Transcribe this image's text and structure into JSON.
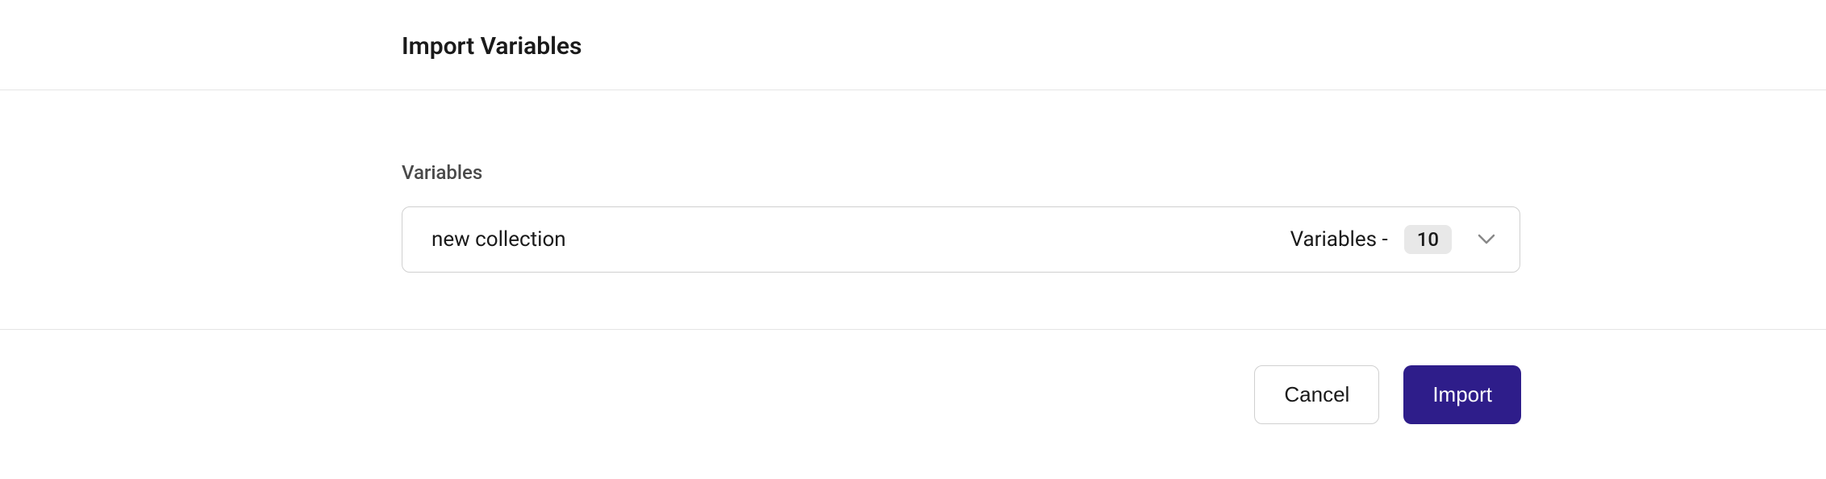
{
  "header": {
    "title": "Import Variables"
  },
  "form": {
    "field_label": "Variables",
    "select": {
      "value": "new collection",
      "suffix_label": "Variables -",
      "count": "10"
    }
  },
  "footer": {
    "cancel_label": "Cancel",
    "import_label": "Import"
  }
}
